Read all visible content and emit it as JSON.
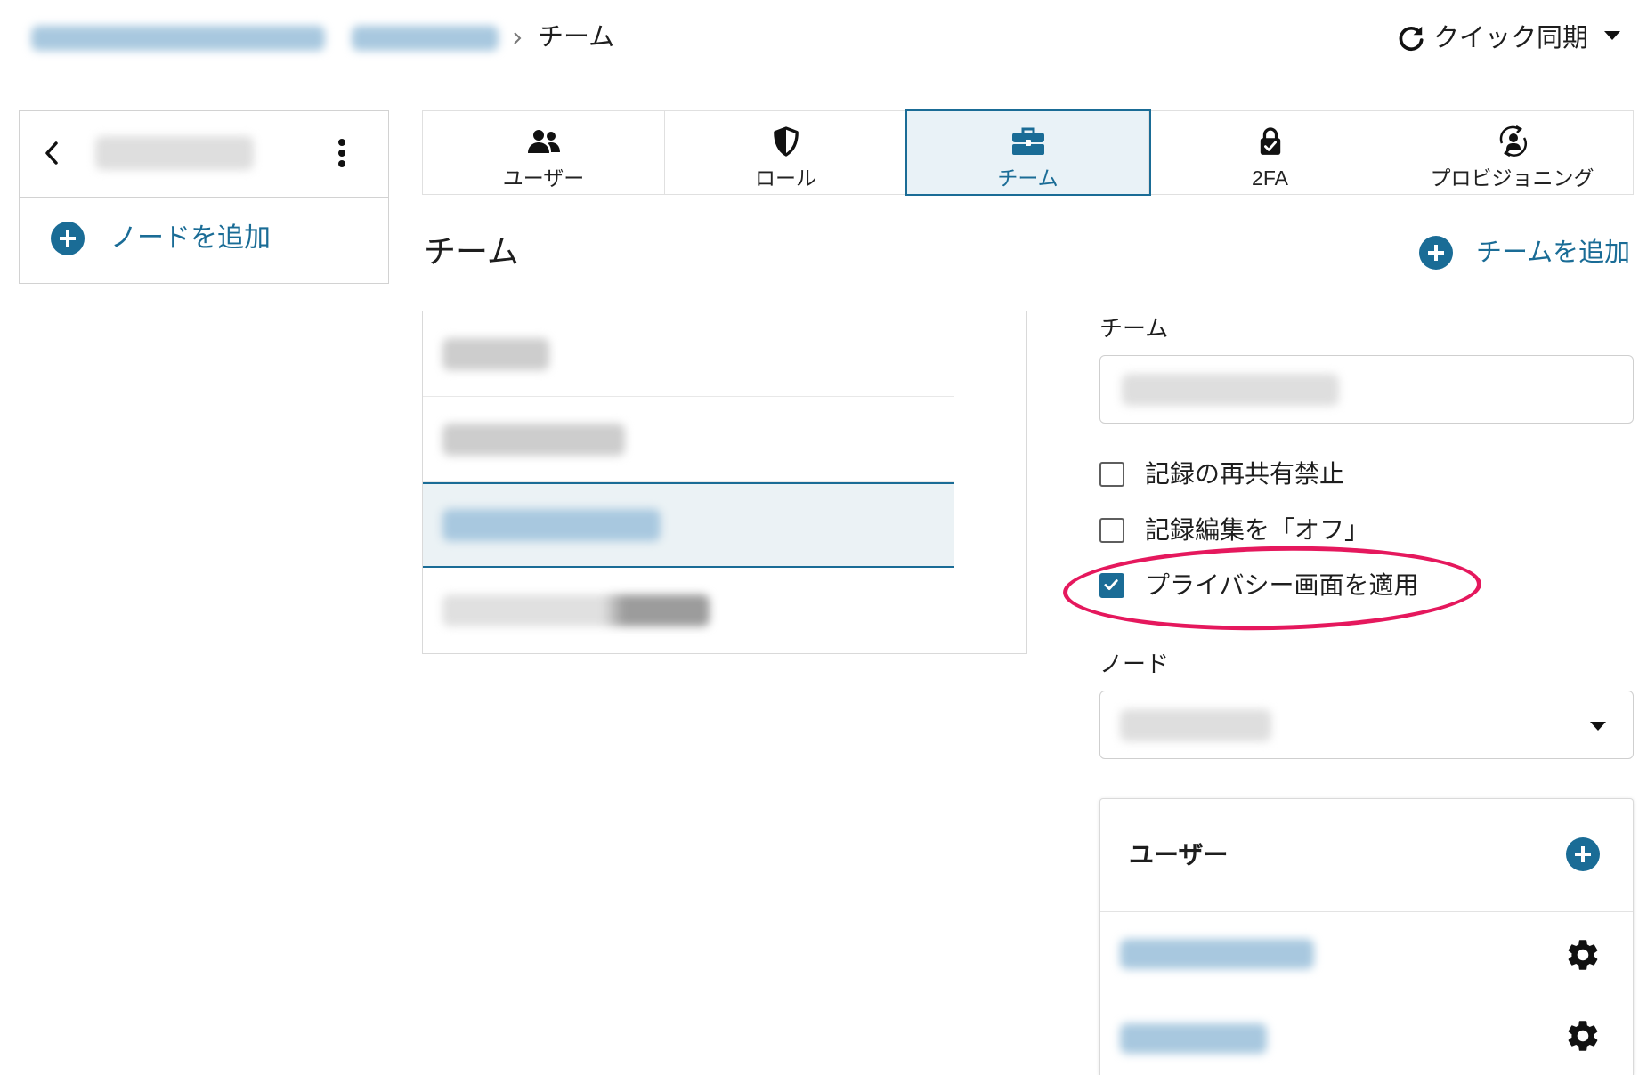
{
  "breadcrumb": {
    "current": "チーム"
  },
  "header": {
    "sync_label": "クイック同期",
    "sync_icon": "refresh-icon"
  },
  "node_panel": {
    "add_node_label": "ノードを追加"
  },
  "tabs": [
    {
      "label": "ユーザー",
      "icon": "users-icon",
      "active": false
    },
    {
      "label": "ロール",
      "icon": "shield-icon",
      "active": false
    },
    {
      "label": "チーム",
      "icon": "briefcase-icon",
      "active": true
    },
    {
      "label": "2FA",
      "icon": "lock-check-icon",
      "active": false
    },
    {
      "label": "プロビジョニング",
      "icon": "provisioning-icon",
      "active": false
    }
  ],
  "main": {
    "title": "チーム",
    "add_team_label": "チームを追加"
  },
  "team_form": {
    "team_label": "チーム",
    "restrictions": [
      {
        "label": "記録の再共有禁止",
        "checked": false
      },
      {
        "label": "記録編集を「オフ」",
        "checked": false
      },
      {
        "label": "プライバシー画面を適用",
        "checked": true
      }
    ],
    "node_label": "ノード"
  },
  "users_card": {
    "title": "ユーザー",
    "row_icon": "gear-icon"
  },
  "colors": {
    "accent": "#1a6c96",
    "highlight": "#e5185d",
    "active_bg": "#e9f2f7"
  }
}
